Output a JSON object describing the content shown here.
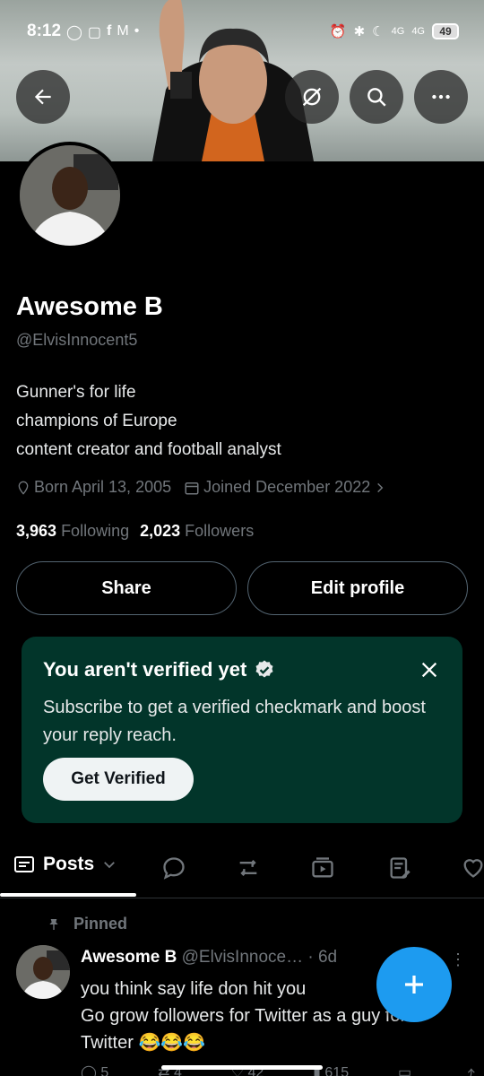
{
  "status_bar": {
    "time": "8:12",
    "battery": "49",
    "network1": "4G",
    "network2": "4G"
  },
  "profile": {
    "name": "Awesome B",
    "handle": "@ElvisInnocent5",
    "bio": [
      "Gunner's for life",
      "champions of Europe",
      "content creator and football analyst"
    ],
    "born": "Born April 13, 2005",
    "joined": "Joined December 2022",
    "following_count": "3,963",
    "following_label": "Following",
    "followers_count": "2,023",
    "followers_label": "Followers"
  },
  "buttons": {
    "share": "Share",
    "edit_profile": "Edit profile"
  },
  "verify_card": {
    "title": "You aren't verified yet",
    "text": "Subscribe to get a verified checkmark and boost your reply reach.",
    "button": "Get Verified"
  },
  "tabs": {
    "posts": "Posts",
    "icons": [
      "replies-icon",
      "retweet-icon",
      "media-icon",
      "articles-icon",
      "likes-icon"
    ]
  },
  "pinned_post": {
    "pinned_label": "Pinned",
    "author": "Awesome B",
    "handle": "@ElvisInnoce…",
    "time": "· 6d",
    "lines": [
      "you think say life don hit you",
      "Go grow followers for Twitter as a guy for",
      "Twitter 😂😂😂"
    ],
    "replies": "5",
    "reposts": "4",
    "likes": "42",
    "views": "615"
  },
  "colors": {
    "accent": "#1d9bf0",
    "verify_bg": "#02352a",
    "muted": "#71767b"
  }
}
